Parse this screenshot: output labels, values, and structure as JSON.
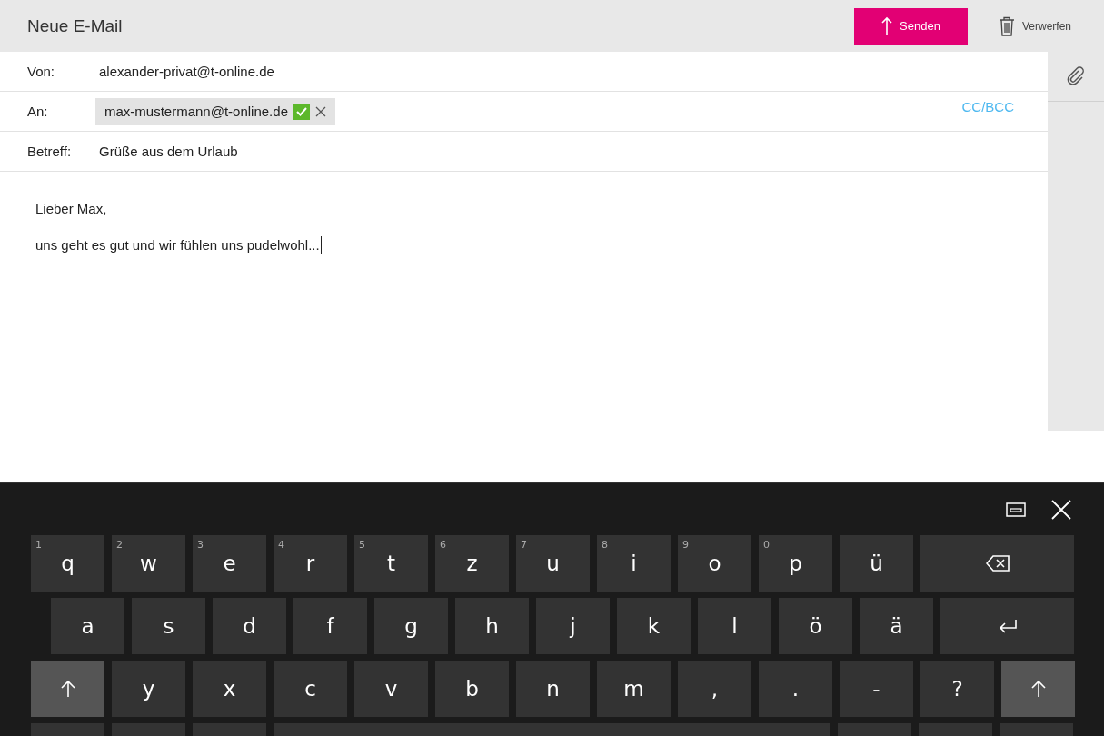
{
  "window": {
    "title": "Neue E-Mail"
  },
  "toolbar": {
    "send": "Senden",
    "discard": "Verwerfen"
  },
  "fields": [
    {
      "kind": "text",
      "label": "Von:",
      "value": "alexander-privat@t-online.de"
    },
    {
      "kind": "recipients",
      "label": "An:",
      "chips": [
        {
          "address": "max-mustermann@t-online.de",
          "verified": true
        }
      ],
      "link": "CC/BCC"
    },
    {
      "kind": "text",
      "label": "Betreff:",
      "value": "Grüße aus dem Urlaub"
    }
  ],
  "body": {
    "lines": [
      "Lieber Max,",
      "uns geht es gut und wir fühlen uns pudelwohl..."
    ]
  },
  "keyboard": {
    "rows": [
      [
        {
          "kind": "char",
          "label": "q",
          "hint": "1"
        },
        {
          "kind": "char",
          "label": "w",
          "hint": "2"
        },
        {
          "kind": "char",
          "label": "e",
          "hint": "3"
        },
        {
          "kind": "char",
          "label": "r",
          "hint": "4"
        },
        {
          "kind": "char",
          "label": "t",
          "hint": "5"
        },
        {
          "kind": "char",
          "label": "z",
          "hint": "6"
        },
        {
          "kind": "char",
          "label": "u",
          "hint": "7"
        },
        {
          "kind": "char",
          "label": "i",
          "hint": "8"
        },
        {
          "kind": "char",
          "label": "o",
          "hint": "9"
        },
        {
          "kind": "char",
          "label": "p",
          "hint": "0"
        },
        {
          "kind": "char",
          "label": "ü"
        },
        {
          "kind": "backspace"
        }
      ],
      [
        {
          "kind": "char",
          "label": "a"
        },
        {
          "kind": "char",
          "label": "s"
        },
        {
          "kind": "char",
          "label": "d"
        },
        {
          "kind": "char",
          "label": "f"
        },
        {
          "kind": "char",
          "label": "g"
        },
        {
          "kind": "char",
          "label": "h"
        },
        {
          "kind": "char",
          "label": "j"
        },
        {
          "kind": "char",
          "label": "k"
        },
        {
          "kind": "char",
          "label": "l"
        },
        {
          "kind": "char",
          "label": "ö"
        },
        {
          "kind": "char",
          "label": "ä"
        },
        {
          "kind": "enter"
        }
      ],
      [
        {
          "kind": "shift"
        },
        {
          "kind": "char",
          "label": "y"
        },
        {
          "kind": "char",
          "label": "x"
        },
        {
          "kind": "char",
          "label": "c"
        },
        {
          "kind": "char",
          "label": "v"
        },
        {
          "kind": "char",
          "label": "b"
        },
        {
          "kind": "char",
          "label": "n"
        },
        {
          "kind": "char",
          "label": "m"
        },
        {
          "kind": "char",
          "label": ","
        },
        {
          "kind": "char",
          "label": "."
        },
        {
          "kind": "char",
          "label": "-"
        },
        {
          "kind": "char",
          "label": "?"
        },
        {
          "kind": "shift"
        }
      ],
      [
        {
          "kind": "blank"
        },
        {
          "kind": "blank"
        },
        {
          "kind": "blank"
        },
        {
          "kind": "space"
        },
        {
          "kind": "blank"
        },
        {
          "kind": "blank"
        },
        {
          "kind": "blank"
        }
      ]
    ]
  }
}
